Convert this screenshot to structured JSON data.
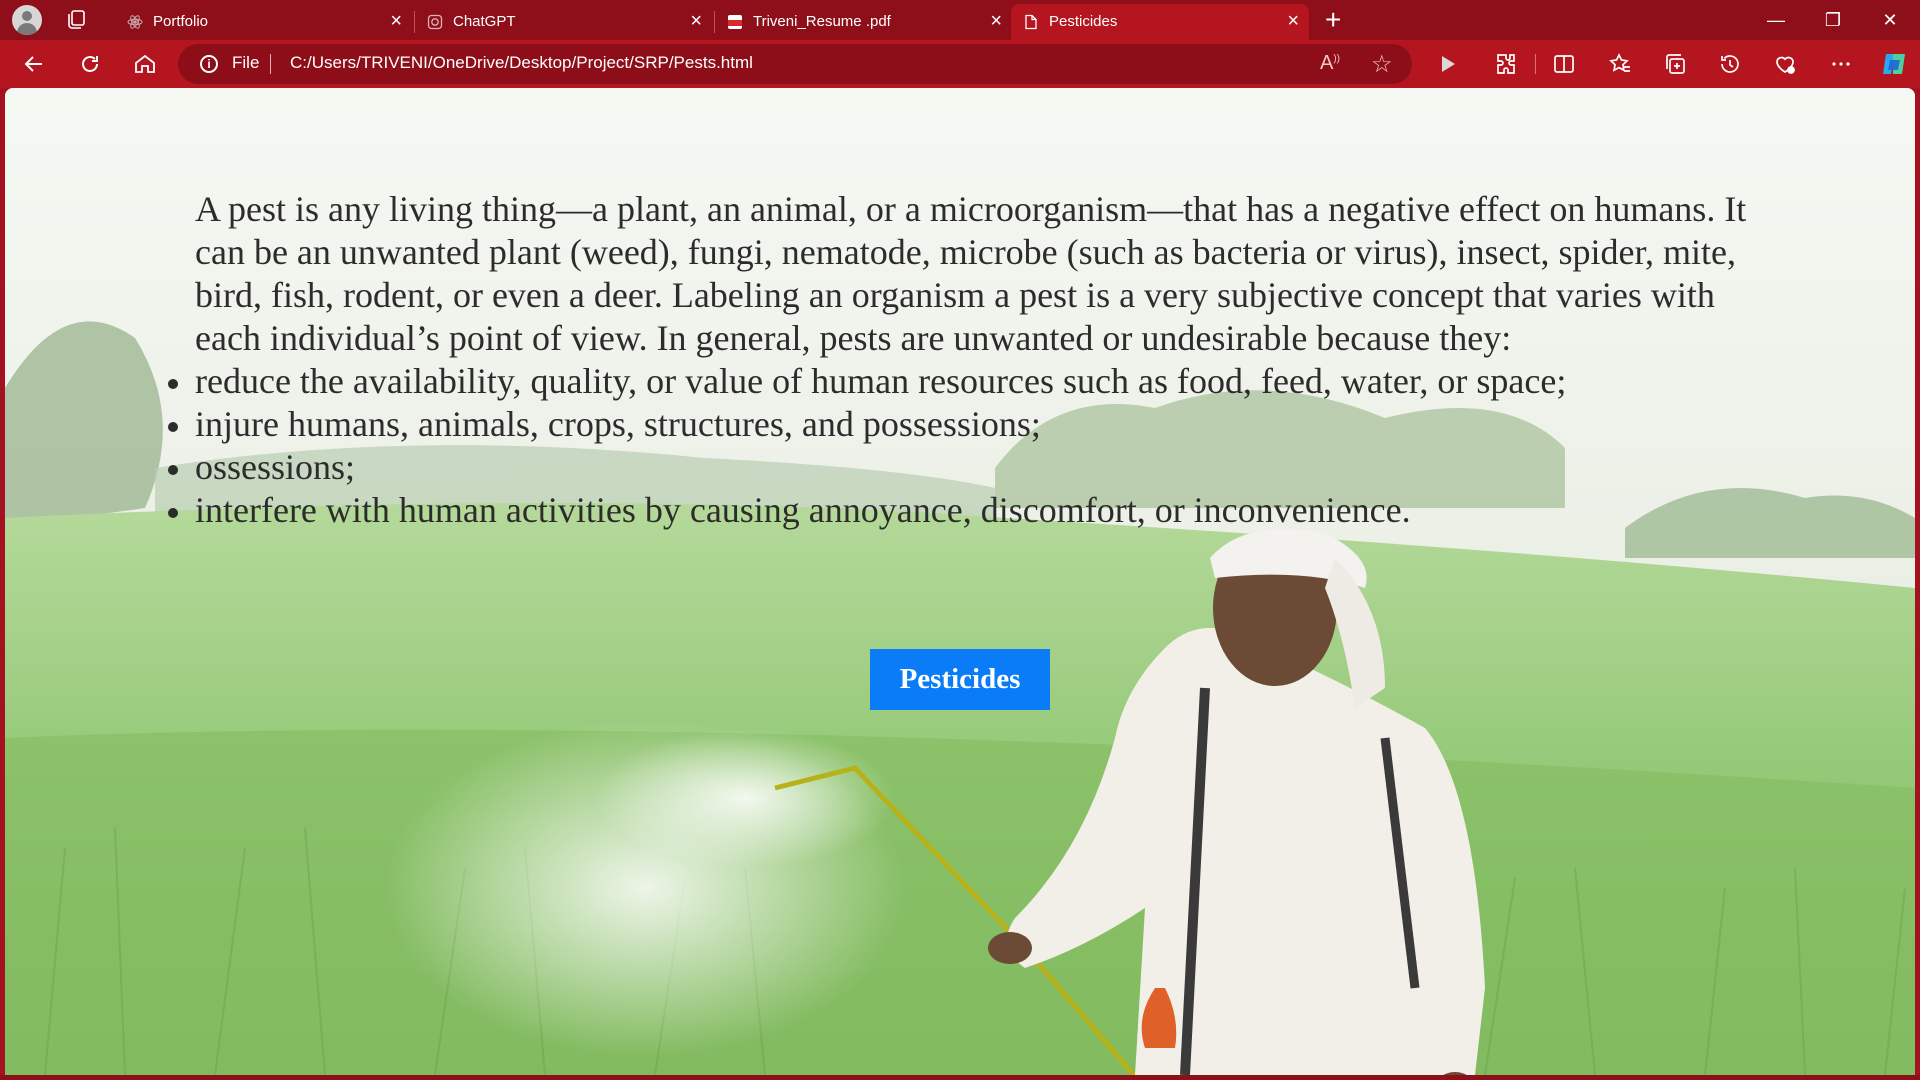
{
  "browser": {
    "tabs": [
      {
        "title": "Portfolio",
        "favicon": "react-icon",
        "active": false
      },
      {
        "title": "ChatGPT",
        "favicon": "chatgpt-icon",
        "active": false
      },
      {
        "title": "Triveni_Resume .pdf",
        "favicon": "pdf-icon",
        "active": false
      },
      {
        "title": "Pesticides",
        "favicon": "page-icon",
        "active": true
      }
    ],
    "address": {
      "scheme_label": "File",
      "url": "C:/Users/TRIVENI/OneDrive/Desktop/Project/SRP/Pests.html"
    },
    "accent_color": "#b4151f"
  },
  "page": {
    "intro": "A pest is any living thing—a plant, an animal, or a microorganism—that has a negative effect on humans. It can be an unwanted plant (weed), fungi, nematode, microbe (such as bacteria or virus), insect, spider, mite, bird, fish, rodent, or even a deer. Labeling an organism a pest is a very subjective concept that varies with each individual’s point of view. In general, pests are unwanted or undesirable because they:",
    "reasons": [
      "reduce the availability, quality, or value of human resources such as food, feed, water, or space;",
      "injure humans, animals, crops, structures, and possessions;",
      "ossessions;",
      "interfere with human activities by causing annoyance, discomfort, or inconvenience."
    ],
    "button_label": "Pesticides",
    "button_color": "#0a7cf8"
  }
}
